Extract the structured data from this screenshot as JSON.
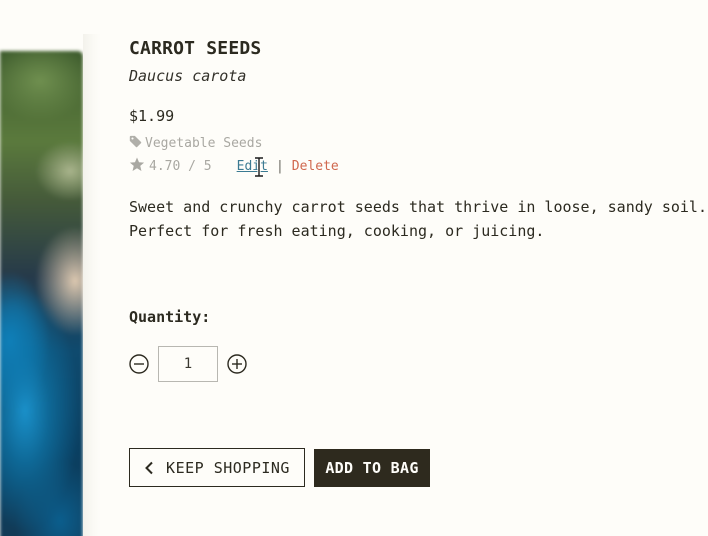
{
  "product": {
    "name": "CARROT SEEDS",
    "latin_name": "Daucus carota",
    "price": "$1.99",
    "category": "Vegetable Seeds",
    "rating": "4.70 / 5",
    "description": "Sweet and crunchy carrot seeds that thrive in loose, sandy soil.\nPerfect for fresh eating, cooking, or juicing."
  },
  "actions": {
    "edit_label": "Edit",
    "separator": "|",
    "delete_label": "Delete"
  },
  "quantity": {
    "label": "Quantity:",
    "value": "1"
  },
  "buttons": {
    "keep_shopping": "KEEP SHOPPING",
    "add_to_bag": "ADD TO BAG"
  },
  "icons": {
    "category": "tag-icon",
    "rating": "star-icon",
    "decrement": "minus-circle-icon",
    "increment": "plus-circle-icon",
    "back": "chevron-left-icon",
    "cursor": "text-cursor-icon"
  },
  "colors": {
    "text": "#2c2a20",
    "muted": "#a9a8a2",
    "link": "#3b7a92",
    "danger": "#d0684e",
    "primary_button": "#2e2a1e",
    "background": "#fefdf9"
  }
}
